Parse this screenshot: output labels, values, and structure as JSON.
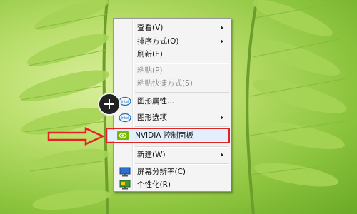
{
  "menu": {
    "items": [
      {
        "label": "查看(V)",
        "submenu": true,
        "disabled": false
      },
      {
        "label": "排序方式(O)",
        "submenu": true,
        "disabled": false
      },
      {
        "label": "刷新(E)",
        "submenu": false,
        "disabled": false
      },
      {
        "label": "粘贴(P)",
        "submenu": false,
        "disabled": true
      },
      {
        "label": "粘贴快捷方式(S)",
        "submenu": false,
        "disabled": true
      },
      {
        "label": "图形属性...",
        "submenu": false,
        "disabled": false,
        "icon": "intel-icon"
      },
      {
        "label": "图形选项",
        "submenu": true,
        "disabled": false,
        "icon": "intel-icon"
      },
      {
        "label": "NVIDIA 控制面板",
        "submenu": false,
        "disabled": false,
        "icon": "nvidia-icon",
        "highlighted": true
      },
      {
        "label": "新建(W)",
        "submenu": true,
        "disabled": false
      },
      {
        "label": "屏幕分辨率(C)",
        "submenu": false,
        "disabled": false,
        "icon": "monitor-icon"
      },
      {
        "label": "个性化(R)",
        "submenu": false,
        "disabled": false,
        "icon": "personalize-icon"
      }
    ]
  },
  "colors": {
    "highlight_border": "#e32222",
    "arrow": "#e32222",
    "menu_bg": "#f4f4f4"
  }
}
